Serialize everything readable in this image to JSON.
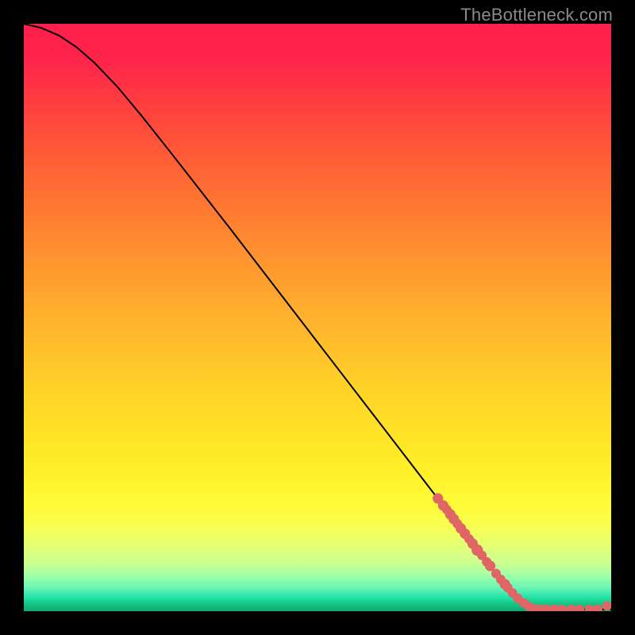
{
  "credit": "TheBottleneck.com",
  "chart_data": {
    "type": "line",
    "title": "",
    "xlabel": "",
    "ylabel": "",
    "xlim": [
      0,
      100
    ],
    "ylim": [
      0,
      100
    ],
    "grid": false,
    "curve": [
      {
        "x": 0,
        "y": 100.0
      },
      {
        "x": 3,
        "y": 99.3
      },
      {
        "x": 6,
        "y": 98.0
      },
      {
        "x": 9,
        "y": 96.0
      },
      {
        "x": 12,
        "y": 93.4
      },
      {
        "x": 16,
        "y": 89.2
      },
      {
        "x": 20,
        "y": 84.4
      },
      {
        "x": 25,
        "y": 78.1
      },
      {
        "x": 30,
        "y": 71.7
      },
      {
        "x": 35,
        "y": 65.3
      },
      {
        "x": 40,
        "y": 58.8
      },
      {
        "x": 45,
        "y": 52.3
      },
      {
        "x": 50,
        "y": 45.8
      },
      {
        "x": 55,
        "y": 39.3
      },
      {
        "x": 60,
        "y": 32.8
      },
      {
        "x": 65,
        "y": 26.3
      },
      {
        "x": 70,
        "y": 19.8
      },
      {
        "x": 75,
        "y": 13.3
      },
      {
        "x": 80,
        "y": 6.9
      },
      {
        "x": 83,
        "y": 3.3
      },
      {
        "x": 85,
        "y": 1.4
      },
      {
        "x": 86,
        "y": 0.7
      },
      {
        "x": 87,
        "y": 0.4
      },
      {
        "x": 90,
        "y": 0.3
      },
      {
        "x": 95,
        "y": 0.3
      },
      {
        "x": 100,
        "y": 0.3
      }
    ],
    "red_points": [
      {
        "x": 70.5,
        "y": 19.2,
        "r": 1.1
      },
      {
        "x": 71.4,
        "y": 18.0,
        "r": 1.1
      },
      {
        "x": 72.0,
        "y": 17.3,
        "r": 1.0
      },
      {
        "x": 72.6,
        "y": 16.5,
        "r": 1.1
      },
      {
        "x": 73.2,
        "y": 15.7,
        "r": 1.1
      },
      {
        "x": 73.8,
        "y": 14.9,
        "r": 1.0
      },
      {
        "x": 74.4,
        "y": 14.1,
        "r": 1.1
      },
      {
        "x": 75.1,
        "y": 13.2,
        "r": 1.1
      },
      {
        "x": 75.8,
        "y": 12.3,
        "r": 1.0
      },
      {
        "x": 76.4,
        "y": 11.5,
        "r": 1.1
      },
      {
        "x": 77.2,
        "y": 10.4,
        "r": 1.2
      },
      {
        "x": 78.0,
        "y": 9.5,
        "r": 1.0
      },
      {
        "x": 78.8,
        "y": 8.4,
        "r": 1.0
      },
      {
        "x": 79.4,
        "y": 7.7,
        "r": 1.1
      },
      {
        "x": 80.4,
        "y": 6.4,
        "r": 1.0
      },
      {
        "x": 81.2,
        "y": 5.4,
        "r": 1.0
      },
      {
        "x": 81.9,
        "y": 4.6,
        "r": 1.1
      },
      {
        "x": 82.4,
        "y": 4.0,
        "r": 1.0
      },
      {
        "x": 83.2,
        "y": 3.1,
        "r": 1.0
      },
      {
        "x": 84.1,
        "y": 2.2,
        "r": 1.0
      },
      {
        "x": 85.1,
        "y": 1.4,
        "r": 1.0
      },
      {
        "x": 86.0,
        "y": 0.8,
        "r": 1.0
      },
      {
        "x": 87.0,
        "y": 0.4,
        "r": 1.0
      },
      {
        "x": 88.1,
        "y": 0.3,
        "r": 1.0
      },
      {
        "x": 89.1,
        "y": 0.3,
        "r": 1.0
      },
      {
        "x": 90.4,
        "y": 0.3,
        "r": 1.0
      },
      {
        "x": 91.6,
        "y": 0.3,
        "r": 1.0
      },
      {
        "x": 93.2,
        "y": 0.3,
        "r": 1.0
      },
      {
        "x": 94.6,
        "y": 0.3,
        "r": 1.0
      },
      {
        "x": 96.3,
        "y": 0.3,
        "r": 1.0
      },
      {
        "x": 97.7,
        "y": 0.3,
        "r": 1.0
      },
      {
        "x": 99.3,
        "y": 0.9,
        "r": 1.0
      }
    ],
    "colors": {
      "curve": "#000000",
      "points": "#e06666",
      "background_top": "#ff1f4b",
      "background_bottom": "#12ab70"
    }
  }
}
